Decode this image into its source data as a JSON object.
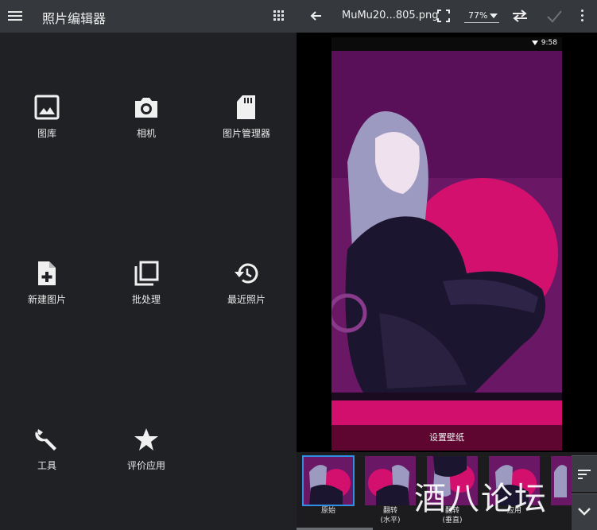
{
  "left_panel": {
    "title": "照片编辑器",
    "tiles": [
      {
        "label": "图库",
        "icon": "gallery-icon"
      },
      {
        "label": "相机",
        "icon": "camera-icon"
      },
      {
        "label": "图片管理器",
        "icon": "sd-card-icon"
      },
      {
        "label": "新建图片",
        "icon": "new-file-icon"
      },
      {
        "label": "批处理",
        "icon": "batch-icon"
      },
      {
        "label": "最近照片",
        "icon": "history-icon"
      },
      {
        "label": "工具",
        "icon": "wrench-icon"
      },
      {
        "label": "评价应用",
        "icon": "star-icon"
      }
    ]
  },
  "right_panel": {
    "file_name": "MuMu20...805.png",
    "zoom": "77%",
    "status_time": "9:58",
    "set_wallpaper": "设置壁纸",
    "thumbnails": [
      {
        "label": "原始",
        "selected": true
      },
      {
        "label": "翻转\n(水平)",
        "selected": false
      },
      {
        "label": "翻转\n(垂直)",
        "selected": false
      },
      {
        "label": "应用",
        "selected": false
      }
    ],
    "watermark": "酒八论坛"
  },
  "colors": {
    "bg": "#202124",
    "toolbar": "#35383d",
    "accent": "#2f8fe4",
    "wallpaper_bg": "#6a1766",
    "sun": "#d4106e"
  }
}
